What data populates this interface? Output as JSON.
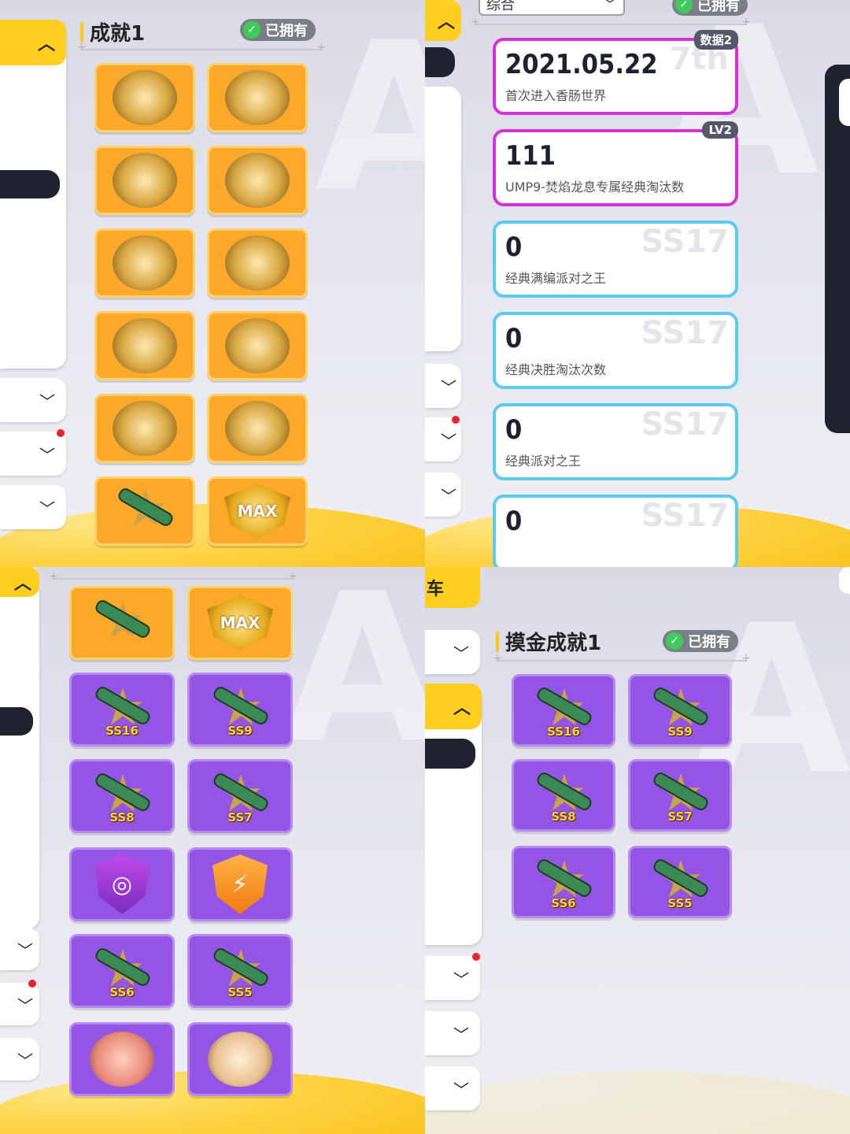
{
  "top_left": {
    "section_title": "成就1",
    "owned_label": "已拥有",
    "tiles": [
      "orange",
      "orange",
      "orange",
      "orange",
      "orange",
      "orange",
      "orange",
      "orange",
      "orange",
      "orange",
      "orange-rocket",
      "orange-max"
    ],
    "max_text": "MAX"
  },
  "top_right": {
    "dropdown_label": "综合",
    "owned_label": "已拥有",
    "cards": [
      {
        "value": "2021.05.22",
        "desc": "首次进入香肠世界",
        "tag": "数据2",
        "ghost": "7th",
        "style": "pink"
      },
      {
        "value": "111",
        "desc": "UMP9-焚焰龙息专属经典淘汰数",
        "tag": "LV2",
        "ghost": "",
        "style": "pink"
      },
      {
        "value": "0",
        "desc": "经典满编派对之王",
        "tag": "",
        "ghost": "SS17",
        "style": "blue"
      },
      {
        "value": "0",
        "desc": "经典决胜淘汰次数",
        "tag": "",
        "ghost": "SS17",
        "style": "blue"
      },
      {
        "value": "0",
        "desc": "经典派对之王",
        "tag": "",
        "ghost": "SS17",
        "style": "blue"
      },
      {
        "value": "0",
        "desc": "",
        "tag": "",
        "ghost": "SS17",
        "style": "blue"
      }
    ]
  },
  "bottom_left": {
    "max_text": "MAX",
    "rockets": [
      "SS16",
      "SS9",
      "SS8",
      "SS7",
      "SS6",
      "SS5"
    ]
  },
  "bottom_right": {
    "partial_title": "车",
    "section_title": "摸金成就1",
    "owned_label": "已拥有",
    "rockets": [
      "SS16",
      "SS9",
      "SS8",
      "SS7",
      "SS6",
      "SS5"
    ]
  },
  "colors": {
    "accent": "#ffce1f",
    "orange_tile": "#fca829",
    "purple_tile": "#9455e6",
    "owned_green": "#3fcb5a",
    "pink_border": "#d431d9",
    "blue_border": "#5dcaf0"
  }
}
